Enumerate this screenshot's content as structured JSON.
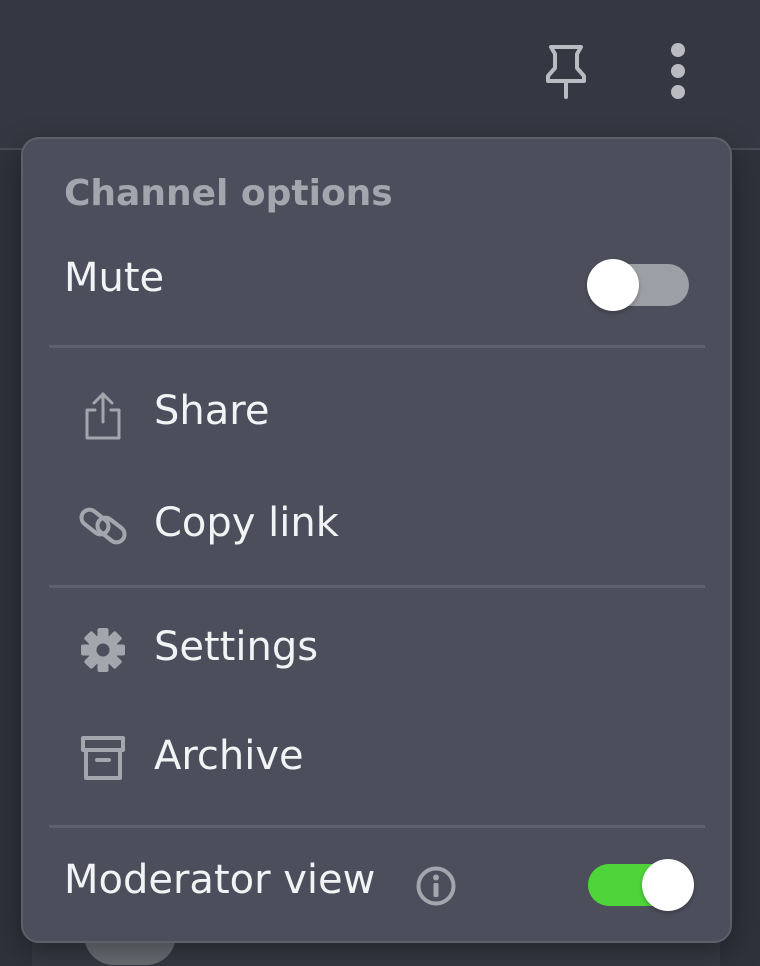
{
  "topbar": {
    "pin_icon": "pin-icon",
    "more_icon": "more-vertical-icon"
  },
  "menu": {
    "title": "Channel options",
    "mute": {
      "label": "Mute",
      "enabled": false
    },
    "items": [
      {
        "label": "Share",
        "icon": "share-icon"
      },
      {
        "label": "Copy link",
        "icon": "link-icon"
      },
      {
        "label": "Settings",
        "icon": "gear-icon"
      },
      {
        "label": "Archive",
        "icon": "archive-icon"
      }
    ],
    "moderator_view": {
      "label": "Moderator view",
      "info_icon": "info-icon",
      "enabled": true
    }
  },
  "colors": {
    "toggle_on": "#4fd53a",
    "toggle_off": "#9d9fa6",
    "menu_bg": "#4c4f5b"
  }
}
